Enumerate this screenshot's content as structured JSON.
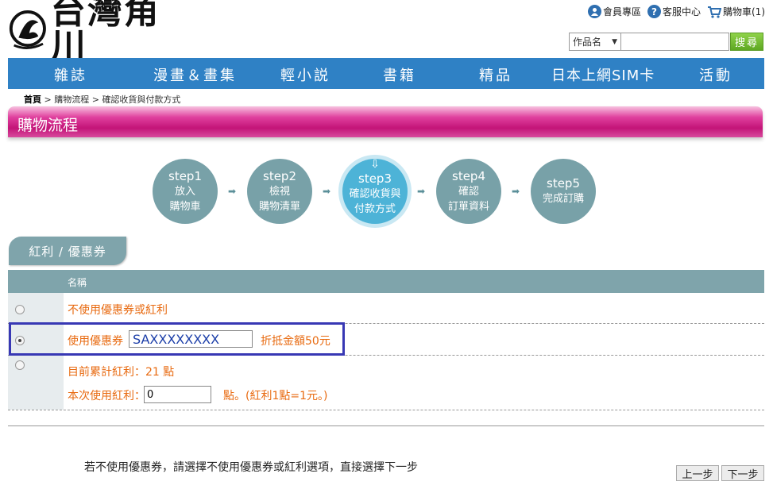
{
  "header": {
    "logo_text": "台灣角川",
    "top_links": [
      {
        "label": "會員專區",
        "icon": "member-icon"
      },
      {
        "label": "客服中心",
        "icon": "help-icon"
      },
      {
        "label": "購物車(1)",
        "icon": "cart-icon"
      }
    ],
    "search": {
      "select_value": "作品名",
      "input_value": "",
      "button_label": "搜尋"
    }
  },
  "nav": {
    "items": [
      "雜誌",
      "漫畫＆畫集",
      "輕小説",
      "書籍",
      "精品",
      "日本上網SIM卡",
      "活動"
    ]
  },
  "breadcrumb": {
    "home": "首頁",
    "sep": ">",
    "level2": "購物流程",
    "level3": "確認收貨與付款方式"
  },
  "page_title": "購物流程",
  "steps": [
    {
      "num": "step1",
      "line1": "放入",
      "line2": "購物車",
      "active": false
    },
    {
      "num": "step2",
      "line1": "檢視",
      "line2": "購物清單",
      "active": false
    },
    {
      "num": "step3",
      "line1": "確認收貨與",
      "line2": "付款方式",
      "active": true
    },
    {
      "num": "step4",
      "line1": "確認",
      "line2": "訂單資料",
      "active": false
    },
    {
      "num": "step5",
      "line1": "完成訂購",
      "line2": "",
      "active": false
    }
  ],
  "section_tab": "紅利 / 優惠券",
  "table": {
    "header_name": "名稱",
    "option_none": "不使用優惠券或紅利",
    "option_coupon_label": "使用優惠券",
    "coupon_code": "SAXXXXXXXX",
    "coupon_discount": "折抵金額50元",
    "bonus_total": "目前累計紅利：21 點",
    "bonus_use_label": "本次使用紅利：",
    "bonus_use_value": "0",
    "bonus_rule": "點。(紅利1點=1元。)"
  },
  "footer": {
    "note": "若不使用優惠券，請選擇不使用優惠券或紅利選項，直接選擇下一步",
    "prev_label": "上一步",
    "next_label": "下一步"
  },
  "colors": {
    "nav_bg": "#2f81c5",
    "title_pink": "#c31478",
    "step_teal": "#78a1a8",
    "step_active": "#4db3d7",
    "accent_orange": "#e86a10",
    "highlight_border": "#3838b4"
  }
}
